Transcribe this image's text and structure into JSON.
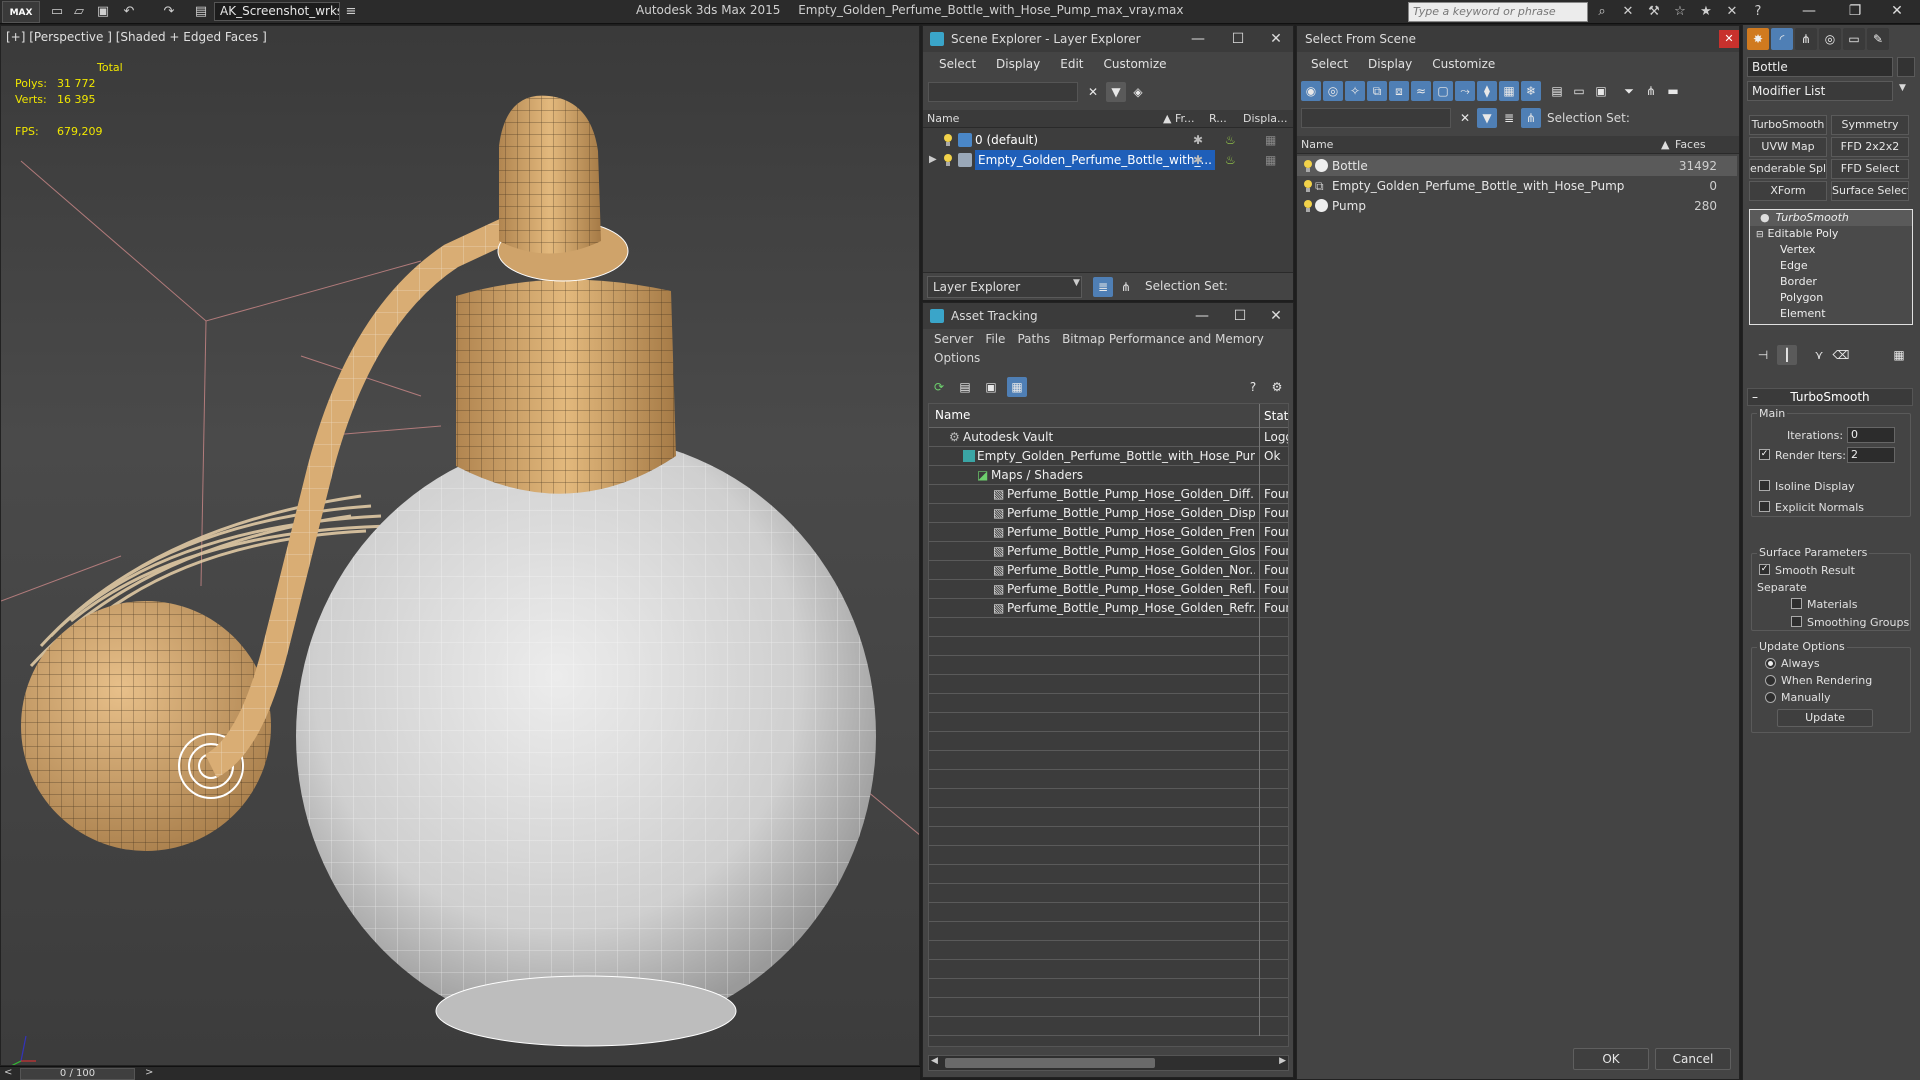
{
  "titlebar": {
    "logo": "MAX",
    "workspace": "AK_Screenshot_wrksp",
    "app_name": "Autodesk 3ds Max  2015",
    "file_name": "Empty_Golden_Perfume_Bottle_with_Hose_Pump_max_vray.max",
    "search_placeholder": "Type a keyword or phrase"
  },
  "viewport": {
    "label": "[+] [Perspective ] [Shaded + Edged Faces ]",
    "stats": {
      "total_label": "Total",
      "polys_label": "Polys:",
      "polys_value": "31 772",
      "verts_label": "Verts:",
      "verts_value": "16 395",
      "fps_label": "FPS:",
      "fps_value": "679,209"
    },
    "colors": {
      "gold": "#d8ad72",
      "white_body": "#d8d8d8",
      "stats_yellow": "#f0e600",
      "wire": "#ffffff"
    }
  },
  "timeline": {
    "frame": "0 / 100",
    "prev": "<",
    "next": ">"
  },
  "scene_explorer": {
    "title": "Scene Explorer - Layer Explorer",
    "menu": [
      "Select",
      "Display",
      "Edit",
      "Customize"
    ],
    "columns": {
      "name": "Name",
      "frozen": "Fr...",
      "render": "R...",
      "display": "Displa..."
    },
    "rows": [
      {
        "name": "0 (default)"
      },
      {
        "name": "Empty_Golden_Perfume_Bottle_with_..."
      }
    ],
    "footer_dropdown": "Layer Explorer",
    "selection_set_label": "Selection Set:"
  },
  "asset_tracking": {
    "title": "Asset Tracking",
    "menu_row1": [
      "Server",
      "File",
      "Paths",
      "Bitmap Performance and Memory"
    ],
    "menu_row2": [
      "Options"
    ],
    "columns": {
      "name": "Name",
      "status": "Status"
    },
    "rows": [
      {
        "name": "Autodesk Vault",
        "status": "Logged"
      },
      {
        "name": "Empty_Golden_Perfume_Bottle_with_Hose_Pum...",
        "status": "Ok"
      },
      {
        "name": "Maps / Shaders",
        "status": ""
      },
      {
        "name": "Perfume_Bottle_Pump_Hose_Golden_Diff...",
        "status": "Found"
      },
      {
        "name": "Perfume_Bottle_Pump_Hose_Golden_Disp...",
        "status": "Found"
      },
      {
        "name": "Perfume_Bottle_Pump_Hose_Golden_Fren...",
        "status": "Found"
      },
      {
        "name": "Perfume_Bottle_Pump_Hose_Golden_Glos...",
        "status": "Found"
      },
      {
        "name": "Perfume_Bottle_Pump_Hose_Golden_Nor...",
        "status": "Found"
      },
      {
        "name": "Perfume_Bottle_Pump_Hose_Golden_Refl...",
        "status": "Found"
      },
      {
        "name": "Perfume_Bottle_Pump_Hose_Golden_Refr...",
        "status": "Found"
      }
    ]
  },
  "select_from_scene": {
    "title": "Select From Scene",
    "menu": [
      "Select",
      "Display",
      "Customize"
    ],
    "selection_set_label": "Selection Set:",
    "columns": {
      "name": "Name",
      "faces": "Faces"
    },
    "rows": [
      {
        "name": "Bottle",
        "faces": "31492"
      },
      {
        "name": "Empty_Golden_Perfume_Bottle_with_Hose_Pump",
        "faces": "0"
      },
      {
        "name": "Pump",
        "faces": "280"
      }
    ],
    "ok_label": "OK",
    "cancel_label": "Cancel"
  },
  "command_panel": {
    "object_name": "Bottle",
    "modifier_list": "Modifier List",
    "modifier_buttons": [
      "TurboSmooth",
      "Symmetry",
      "UVW Map",
      "FFD 2x2x2",
      "enderable Splin",
      "FFD Select",
      "XForm",
      "Surface Select"
    ],
    "stack": [
      "TurboSmooth",
      "Editable Poly",
      "Vertex",
      "Edge",
      "Border",
      "Polygon",
      "Element"
    ],
    "rollout_title": "TurboSmooth",
    "main_label": "Main",
    "iterations_label": "Iterations:",
    "iterations_value": "0",
    "render_iters_label": "Render Iters:",
    "render_iters_value": "2",
    "isoline_label": "Isoline Display",
    "explicit_normals_label": "Explicit Normals",
    "surface_params_label": "Surface Parameters",
    "smooth_result_label": "Smooth Result",
    "separate_label": "Separate",
    "materials_label": "Materials",
    "smoothing_groups_label": "Smoothing Groups",
    "update_options_label": "Update Options",
    "always_label": "Always",
    "when_rendering_label": "When Rendering",
    "manually_label": "Manually",
    "update_button": "Update"
  }
}
